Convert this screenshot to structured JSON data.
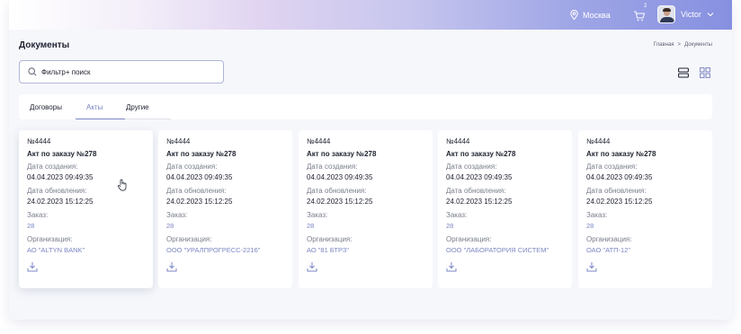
{
  "header": {
    "city": "Москва",
    "cart_badge": "2",
    "user_name": "Victor",
    "icons": {
      "location": "location-pin-icon",
      "cart": "cart-icon",
      "chevron": "chevron-down-icon"
    }
  },
  "page": {
    "title": "Документы",
    "breadcrumb": {
      "home": "Главная",
      "separator": ">",
      "current": "Документы"
    }
  },
  "search": {
    "placeholder": "Фильтр+ поиск",
    "value": ""
  },
  "view_toggle": {
    "list_icon": "list-view-icon",
    "grid_icon": "grid-view-icon"
  },
  "tabs": [
    {
      "label": "Договоры",
      "active": false
    },
    {
      "label": "Акты",
      "active": true
    },
    {
      "label": "Другие",
      "active": false
    }
  ],
  "labels": {
    "created": "Дата создания:",
    "updated": "Дата обновления:",
    "order": "Заказ:",
    "org": "Организация:"
  },
  "cards": [
    {
      "number": "№4444",
      "title": "Акт по заказу №278",
      "created": "04.04.2023 09:49:35",
      "updated": "24.02.2023 15:12:25",
      "order": "28",
      "org": "АО \"ALTYN BANK\""
    },
    {
      "number": "№4444",
      "title": "Акт по заказу №278",
      "created": "04.04.2023 09:49:35",
      "updated": "24.02.2023 15:12:25",
      "order": "28",
      "org": "ООО \"УРАЛПРОГРЕСС-2216\""
    },
    {
      "number": "№4444",
      "title": "Акт по заказу №278",
      "created": "04.04.2023 09:49:35",
      "updated": "24.02.2023 15:12:25",
      "order": "28",
      "org": "АО \"81 БТРЗ\""
    },
    {
      "number": "№4444",
      "title": "Акт по заказу №278",
      "created": "04.04.2023 09:49:35",
      "updated": "24.02.2023 15:12:25",
      "order": "28",
      "org": "ООО \"ЛАБОРАТОРИЯ СИСТЕМ\""
    },
    {
      "number": "№4444",
      "title": "Акт по заказу №278",
      "created": "04.04.2023 09:49:35",
      "updated": "24.02.2023 15:12:25",
      "order": "28",
      "org": "ОАО \"АТП-12\""
    }
  ],
  "colors": {
    "accent": "#7c86c4",
    "text": "#1f2330",
    "muted": "#7a7f8c",
    "background": "#f6f7fb"
  }
}
